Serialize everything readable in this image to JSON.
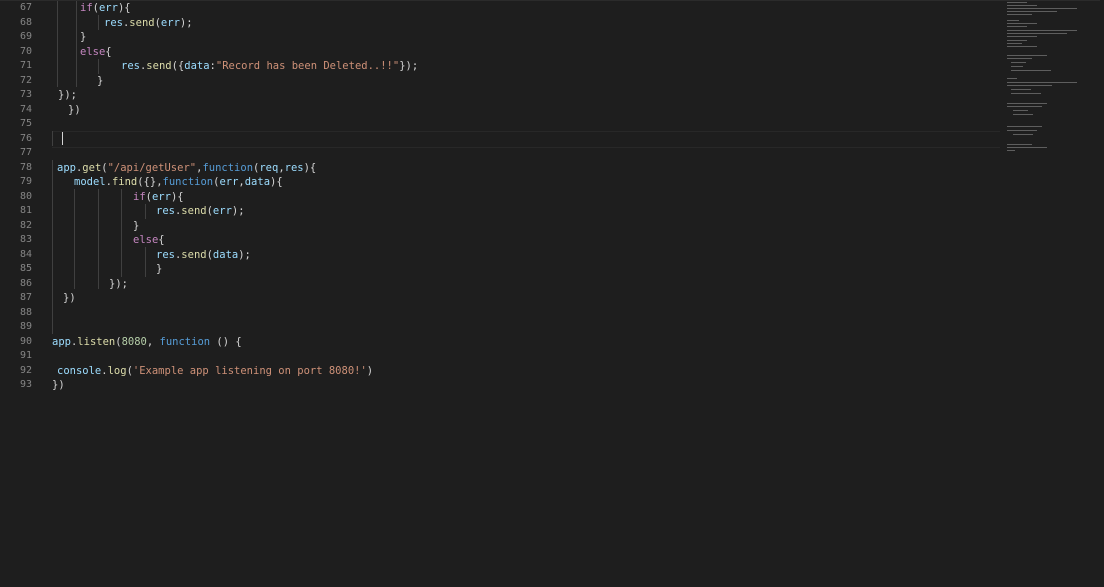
{
  "editor": {
    "line_numbers": [
      "67",
      "68",
      "69",
      "70",
      "71",
      "72",
      "73",
      "74",
      "75",
      "76",
      "77",
      "78",
      "79",
      "80",
      "81",
      "82",
      "83",
      "84",
      "85",
      "86",
      "87",
      "88",
      "89",
      "90",
      "91",
      "92",
      "93"
    ],
    "lines": {
      "l67": {
        "kw": "if",
        "p1": "(",
        "v1": "err",
        "p2": "){"
      },
      "l68": {
        "v1": "res",
        "p1": ".",
        "f1": "send",
        "p2": "(",
        "v2": "err",
        "p3": ");"
      },
      "l69": {
        "p1": "}"
      },
      "l70": {
        "kw": "else",
        "p1": "{"
      },
      "l71": {
        "v1": "res",
        "p1": ".",
        "f1": "send",
        "p2": "({",
        "v2": "data",
        "p3": ":",
        "s1": "\"Record has been Deleted..!!\"",
        "p4": "});"
      },
      "l72": {
        "p1": "}"
      },
      "l73": {
        "p1": "});"
      },
      "l74": {
        "p1": "})"
      },
      "l78": {
        "v1": "app",
        "p1": ".",
        "f1": "get",
        "p2": "(",
        "s1": "\"/api/getUser\"",
        "p3": ",",
        "kb1": "function",
        "p4": "(",
        "v2": "req",
        "p5": ",",
        "v3": "res",
        "p6": "){"
      },
      "l79": {
        "v1": "model",
        "p1": ".",
        "f1": "find",
        "p2": "({},",
        "kb1": "function",
        "p3": "(",
        "v2": "err",
        "p4": ",",
        "v3": "data",
        "p5": "){"
      },
      "l80": {
        "kw": "if",
        "p1": "(",
        "v1": "err",
        "p2": "){"
      },
      "l81": {
        "v1": "res",
        "p1": ".",
        "f1": "send",
        "p2": "(",
        "v2": "err",
        "p3": ");"
      },
      "l82": {
        "p1": "}"
      },
      "l83": {
        "kw": "else",
        "p1": "{"
      },
      "l84": {
        "v1": "res",
        "p1": ".",
        "f1": "send",
        "p2": "(",
        "v2": "data",
        "p3": ");"
      },
      "l85": {
        "p1": "}"
      },
      "l86": {
        "p1": "});"
      },
      "l87": {
        "p1": "})"
      },
      "l90": {
        "v1": "app",
        "p1": ".",
        "f1": "listen",
        "p2": "(",
        "n1": "8080",
        "p3": ", ",
        "kb1": "function",
        "p4": " () {"
      },
      "l92": {
        "v1": "console",
        "p1": ".",
        "f1": "log",
        "p2": "(",
        "s1": "'Example app listening on port 8080!'",
        "p3": ")"
      },
      "l93": {
        "p1": "})"
      }
    }
  },
  "colors": {
    "background": "#1e1e1e",
    "line_number": "#858585",
    "keyword_control": "#c586c0",
    "keyword_storage": "#569cd6",
    "variable": "#9cdcfe",
    "function": "#dcdcaa",
    "string": "#ce9178",
    "number": "#b5cea8"
  }
}
